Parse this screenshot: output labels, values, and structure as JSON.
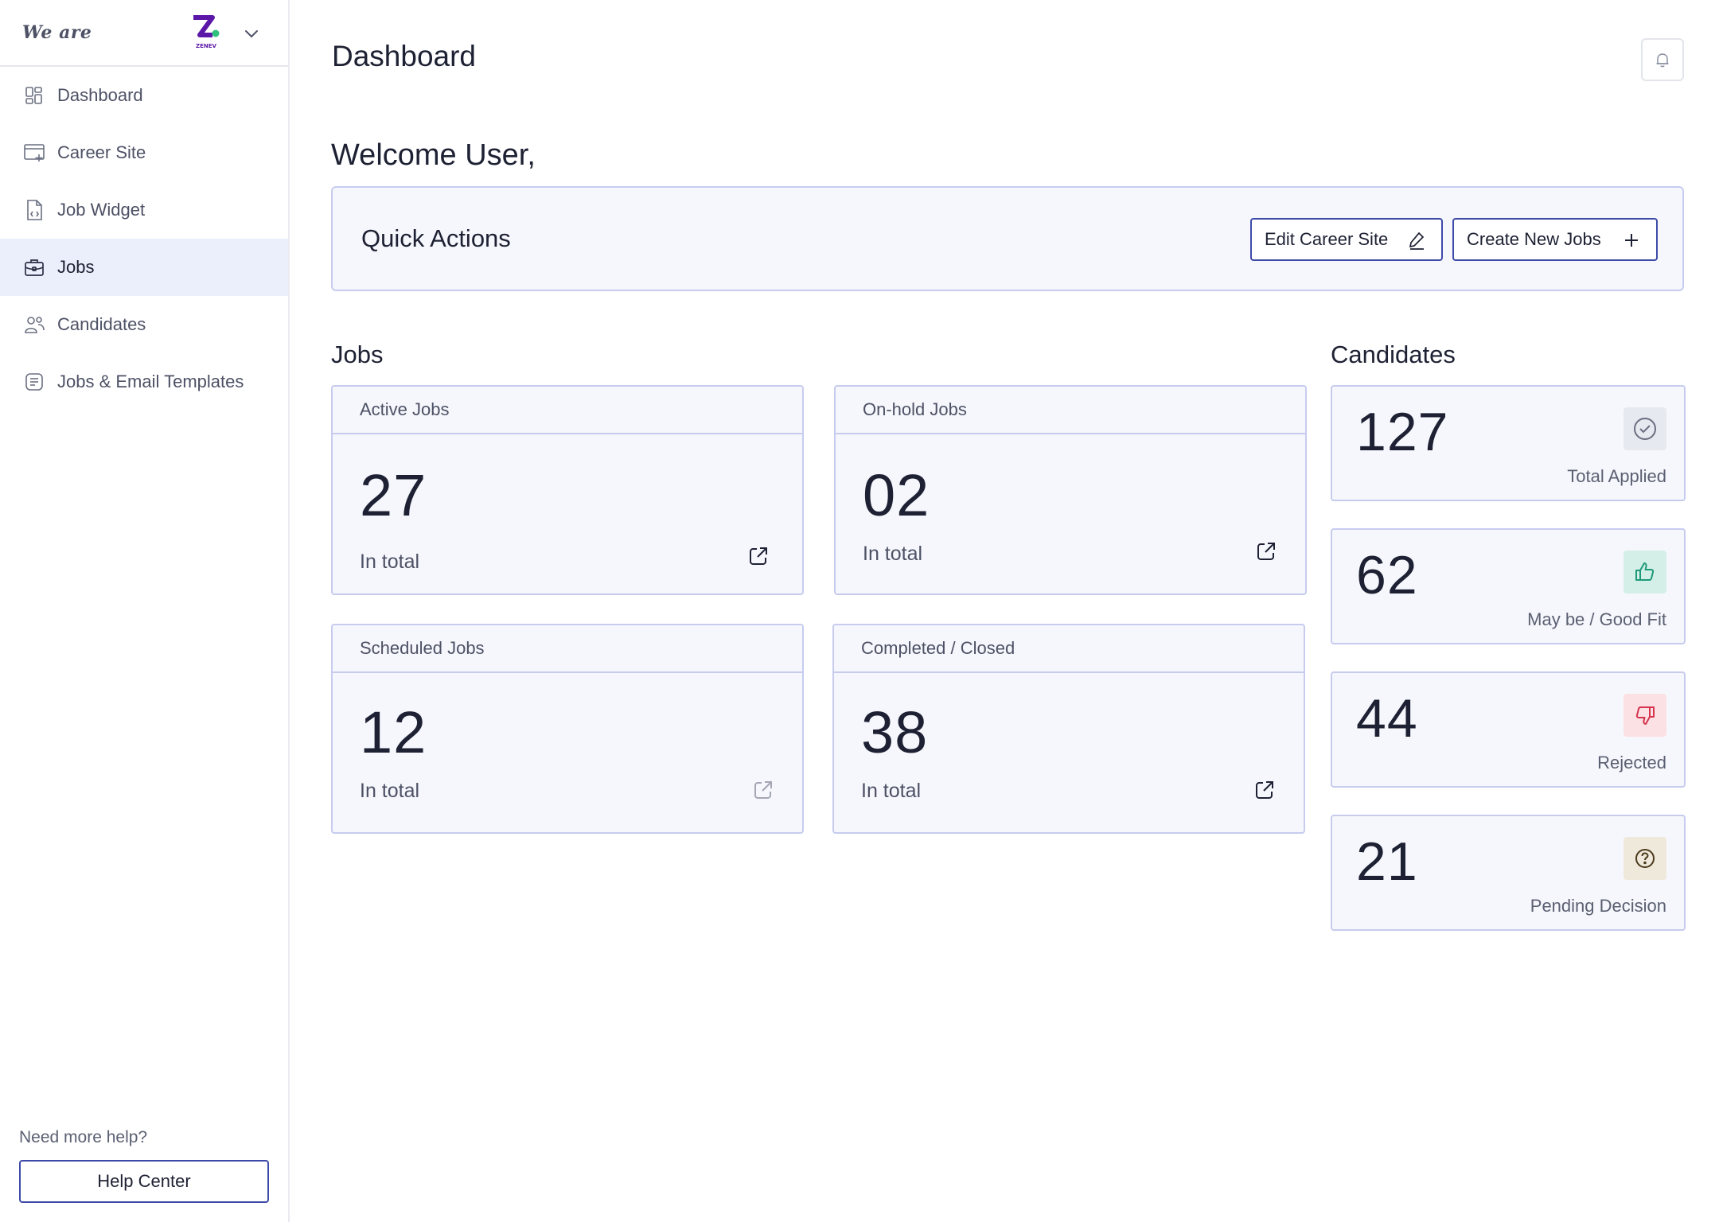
{
  "brand": {
    "text": "We are",
    "logo_text": "ZENEV"
  },
  "sidebar": {
    "items": [
      {
        "label": "Dashboard",
        "icon": "dashboard-icon",
        "active": false
      },
      {
        "label": "Career Site",
        "icon": "career-site-icon",
        "active": false
      },
      {
        "label": "Job Widget",
        "icon": "job-widget-icon",
        "active": false
      },
      {
        "label": "Jobs",
        "icon": "briefcase-icon",
        "active": true
      },
      {
        "label": "Candidates",
        "icon": "users-icon",
        "active": false
      },
      {
        "label": "Jobs & Email Templates",
        "icon": "template-icon",
        "active": false
      }
    ],
    "help_label": "Need more help?",
    "help_button": "Help Center"
  },
  "header": {
    "title": "Dashboard"
  },
  "welcome": "Welcome User,",
  "quick_actions": {
    "title": "Quick Actions",
    "edit_label": "Edit Career Site",
    "create_label": "Create New Jobs"
  },
  "jobs": {
    "title": "Jobs",
    "cards": [
      {
        "title": "Active Jobs",
        "count": "27",
        "sub": "In total"
      },
      {
        "title": "On-hold Jobs",
        "count": "02",
        "sub": "In total"
      },
      {
        "title": "Scheduled Jobs",
        "count": "12",
        "sub": "In total"
      },
      {
        "title": "Completed / Closed",
        "count": "38",
        "sub": "In total"
      }
    ]
  },
  "candidates": {
    "title": "Candidates",
    "cards": [
      {
        "count": "127",
        "label": "Total Applied",
        "icon": "check-circle-icon",
        "color": "#6a6f80",
        "bg": "#e7e9f0"
      },
      {
        "count": "62",
        "label": "May be / Good Fit",
        "icon": "thumbs-up-icon",
        "color": "#1e9a7a",
        "bg": "#d3efe7"
      },
      {
        "count": "44",
        "label": "Rejected",
        "icon": "thumbs-down-icon",
        "color": "#d6334d",
        "bg": "#fbe1e4"
      },
      {
        "count": "21",
        "label": "Pending Decision",
        "icon": "question-circle-icon",
        "color": "#4a3a1a",
        "bg": "#efe9dc"
      }
    ]
  },
  "colors": {
    "accent": "#3e4aa8",
    "card_border": "#c7ccef",
    "card_bg": "#f6f7fc",
    "active_nav": "#ebeefb"
  }
}
